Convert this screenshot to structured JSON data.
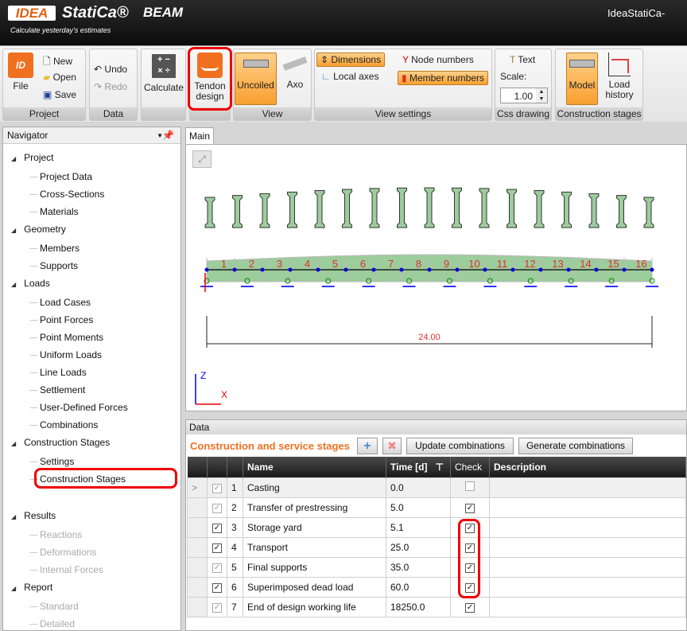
{
  "title": {
    "logo": "IDEA",
    "brand": "StatiCa®",
    "product": "BEAM",
    "tagline": "Calculate yesterday's estimates",
    "window": "IdeaStatiCa-"
  },
  "ribbon": {
    "project": {
      "label": "Project",
      "file": "File",
      "new": "New",
      "open": "Open",
      "save": "Save"
    },
    "data": {
      "label": "Data",
      "undo": "Undo",
      "redo": "Redo"
    },
    "calculate": "Calculate",
    "tendon": "Tendon design",
    "view": {
      "label": "View",
      "uncoiled": "Uncoiled",
      "axo": "Axo"
    },
    "view_settings": {
      "label": "View settings",
      "dimensions": "Dimensions",
      "local_axes": "Local axes",
      "node_numbers": "Node numbers",
      "member_numbers": "Member numbers"
    },
    "css": {
      "label": "Css drawing",
      "text": "Text",
      "scale_label": "Scale:",
      "scale": "1.00"
    },
    "stages": {
      "label": "Construction stages",
      "model": "Model",
      "load_history": "Load history"
    }
  },
  "navigator": {
    "title": "Navigator",
    "items": [
      "Project",
      "Project Data",
      "Cross-Sections",
      "Materials",
      "Geometry",
      "Members",
      "Supports",
      "Loads",
      "Load Cases",
      "Point Forces",
      "Point Moments",
      "Uniform Loads",
      "Line Loads",
      "Settlement",
      "User-Defined Forces",
      "Combinations",
      "Construction Stages",
      "Settings",
      "Construction Stages",
      "Results",
      "Reactions",
      "Deformations",
      "Internal Forces",
      "Report",
      "Standard",
      "Detailed"
    ]
  },
  "main_tab": "Main",
  "drawing": {
    "members": [
      "1",
      "2",
      "3",
      "4",
      "5",
      "6",
      "7",
      "8",
      "9",
      "10",
      "11",
      "12",
      "13",
      "14",
      "15",
      "16"
    ],
    "dimension": "24.00",
    "axis_z": "Z",
    "axis_x": "X"
  },
  "data_panel": {
    "title": "Data",
    "section": "Construction and service stages",
    "update": "Update combinations",
    "generate": "Generate combinations",
    "columns": [
      "Name",
      "Time [d]",
      "Check",
      "Description"
    ],
    "rows": [
      {
        "n": "1",
        "name": "Casting",
        "time": "0.0",
        "active": true,
        "check": false
      },
      {
        "n": "2",
        "name": "Transfer of prestressing",
        "time": "5.0",
        "active": true,
        "check": true
      },
      {
        "n": "3",
        "name": "Storage yard",
        "time": "5.1",
        "active": true,
        "check": true
      },
      {
        "n": "4",
        "name": "Transport",
        "time": "25.0",
        "active": true,
        "check": true
      },
      {
        "n": "5",
        "name": "Final supports",
        "time": "35.0",
        "active": true,
        "check": true
      },
      {
        "n": "6",
        "name": "Superimposed dead load",
        "time": "60.0",
        "active": true,
        "check": true
      },
      {
        "n": "7",
        "name": "End of design working life",
        "time": "18250.0",
        "active": true,
        "check": true
      }
    ]
  },
  "colors": {
    "accent": "#f07020",
    "highlight": "#e00000",
    "member_fill": "#9dcc9d",
    "member_text": "#e03030"
  }
}
